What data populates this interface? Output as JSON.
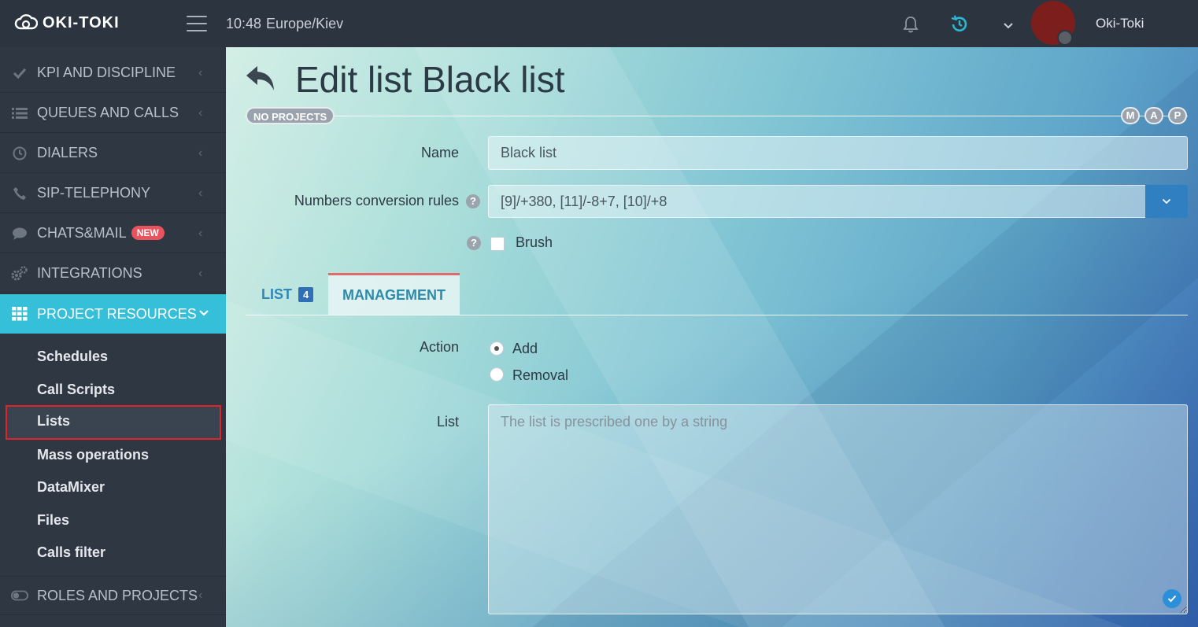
{
  "header": {
    "logo_text": "OKI-TOKI",
    "time": "10:48",
    "timezone": "Europe/Kiev",
    "username": "Oki-Toki"
  },
  "sidebar": {
    "items": [
      {
        "label": "KPI AND DISCIPLINE",
        "icon": "check-icon"
      },
      {
        "label": "QUEUES AND CALLS",
        "icon": "list-icon"
      },
      {
        "label": "DIALERS",
        "icon": "clock-icon"
      },
      {
        "label": "SIP-TELEPHONY",
        "icon": "phone-icon"
      },
      {
        "label": "CHATS&MAIL",
        "icon": "chat-icon",
        "badge": "NEW"
      },
      {
        "label": "INTEGRATIONS",
        "icon": "gears-icon"
      },
      {
        "label": "PROJECT RESOURCES",
        "icon": "grid-icon"
      },
      {
        "label": "ROLES AND PROJECTS",
        "icon": "toggle-icon"
      }
    ],
    "submenu": [
      "Schedules",
      "Call Scripts",
      "Lists",
      "Mass operations",
      "DataMixer",
      "Files",
      "Calls filter"
    ]
  },
  "page": {
    "title": "Edit list Black list",
    "projects_pill": "NO PROJECTS",
    "map_pills": [
      "M",
      "A",
      "P"
    ]
  },
  "form": {
    "name_label": "Name",
    "name_value": "Black list",
    "rules_label": "Numbers conversion rules",
    "rules_value": "[9]/+380, [11]/-8+7, [10]/+8",
    "help_glyph": "?",
    "brush_label": "Brush"
  },
  "tabs": {
    "list_label": "LIST",
    "list_count": "4",
    "management_label": "MANAGEMENT"
  },
  "management": {
    "action_label": "Action",
    "add_label": "Add",
    "removal_label": "Removal",
    "list_label": "List",
    "list_placeholder": "The list is prescribed one by a string"
  },
  "colors": {
    "accent": "#35bfd8",
    "primary": "#2f7fc1",
    "danger": "#e0222b"
  }
}
